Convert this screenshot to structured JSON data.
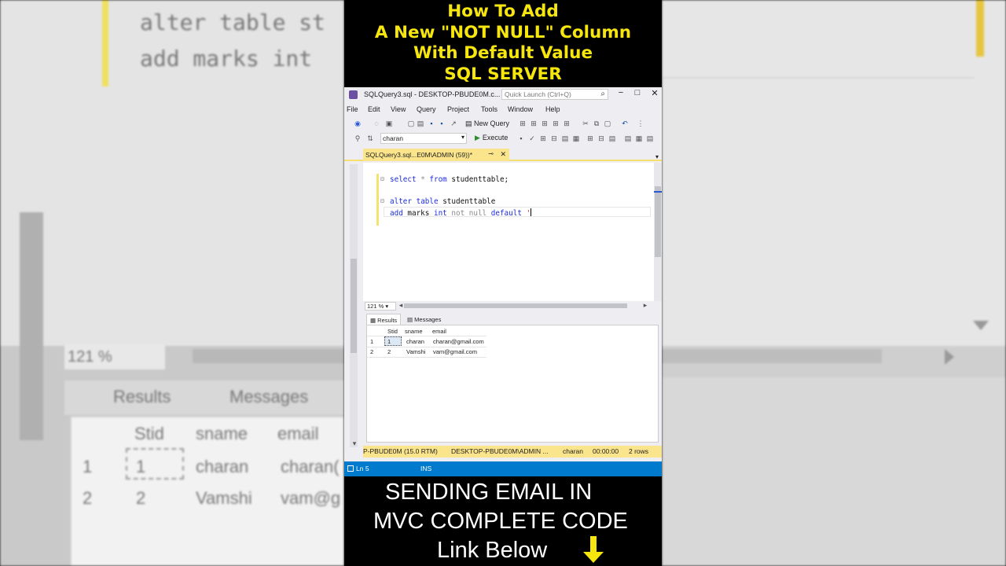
{
  "header": {
    "lines": [
      "How To Add",
      "A New \"NOT NULL\" Column",
      "With  Default Value",
      "SQL SERVER"
    ]
  },
  "window": {
    "title": "SQLQuery3.sql - DESKTOP-PBUDE0M.c...",
    "quick_launch_placeholder": "Quick Launch (Ctrl+Q)",
    "controls": [
      "−",
      "□",
      "✕"
    ]
  },
  "menu": [
    "File",
    "Edit",
    "View",
    "Query",
    "Project",
    "Tools",
    "Window",
    "Help"
  ],
  "toolbar": {
    "new_query_label": "New Query",
    "database_selected": "charan",
    "execute_label": "Execute"
  },
  "document_tab": {
    "label": "SQLQuery3.sql...E0M\\ADMIN (59))*",
    "pin": "⊸",
    "close": "✕"
  },
  "editor": {
    "lines": [
      {
        "kw1": "select",
        "rest": " * ",
        "kw2": "from",
        "tail": " studenttable;"
      },
      {
        "kw1": "alter",
        "kw2": "table",
        "tail": " studenttable"
      },
      {
        "kw1": "add",
        "tail1": " marks ",
        "kw2": "int",
        "gray": " not null ",
        "kw3": "default",
        "str": " '"
      }
    ],
    "zoom": "121 %"
  },
  "results": {
    "tabs": [
      "Results",
      "Messages"
    ],
    "columns": [
      "Stid",
      "sname",
      "email"
    ],
    "rows": [
      {
        "num": "1",
        "stid": "1",
        "sname": "charan",
        "email": "charan@gmail.com"
      },
      {
        "num": "2",
        "stid": "2",
        "sname": "Vamshi",
        "email": "vam@gmail.com"
      }
    ]
  },
  "status": {
    "server": "P-PBUDE0M (15.0 RTM)",
    "user": "DESKTOP-PBUDE0M\\ADMIN ...",
    "db": "charan",
    "time": "00:00:00",
    "rows": "2 rows"
  },
  "bottom_status": {
    "line": "Ln 5",
    "mode": "INS"
  },
  "promo": {
    "line1": "SENDING EMAIL IN",
    "line2": "MVC COMPLETE CODE",
    "line3": "Link Below"
  },
  "background": {
    "code_line1": "alter table st",
    "code_line2": "add marks int",
    "zoom": "121 %",
    "tabs": [
      "Results",
      "Messages"
    ],
    "cols": [
      "Stid",
      "sname",
      "email"
    ],
    "r1": [
      "1",
      "1",
      "charan",
      "charan("
    ],
    "r2": [
      "2",
      "2",
      "Vamshi",
      "vam@g"
    ]
  },
  "colors": {
    "title_yellow": "#f6e60e",
    "status_yellow": "#fbe58c",
    "status_blue": "#007acc",
    "keyword_blue": "#1c2cd9",
    "arrow_yellow": "#f6e60e"
  }
}
